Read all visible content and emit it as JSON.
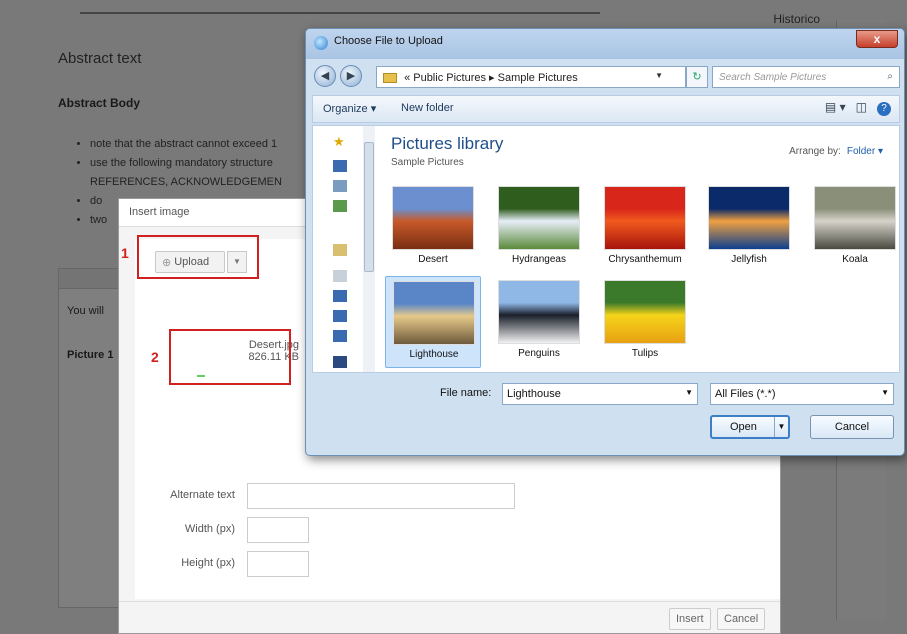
{
  "background_page": {
    "header_right": "Historico",
    "abstract_title": "Abstract text",
    "abstract_body_label": "Abstract Body",
    "bullets": [
      "note that the abstract cannot exceed 1",
      "use the following mandatory structure",
      "REFERENCES, ACKNOWLEDGEMEN",
      "do",
      "two"
    ],
    "editor_line1": "You will",
    "editor_line2": "Picture 1"
  },
  "insert_dialog": {
    "title": "Insert image",
    "upload_label": "Upload",
    "file_name": "Desert.jpg",
    "file_size": "826.11 KB",
    "annotation_1": "1",
    "annotation_2": "2",
    "alt_label": "Alternate text",
    "width_label": "Width (px)",
    "height_label": "Height (px)",
    "insert_label": "Insert",
    "cancel_label": "Cancel"
  },
  "file_dialog": {
    "title": "Choose File to Upload",
    "close_label": "x",
    "address": "« Public Pictures  ▸  Sample Pictures",
    "search_placeholder": "Search Sample Pictures",
    "organize_label": "Organize ▾",
    "new_folder_label": "New folder",
    "library_title": "Pictures library",
    "library_subtitle": "Sample Pictures",
    "arrange_by_label": "Arrange by:",
    "arrange_by_value": "Folder ▾",
    "thumbnails": [
      {
        "name": "Desert",
        "selected": false,
        "colors": [
          "#6b8fcf",
          "#c75a2a",
          "#7a2e12"
        ]
      },
      {
        "name": "Hydrangeas",
        "selected": false,
        "colors": [
          "#2f5d1e",
          "#e8eef8",
          "#5a8a3a"
        ]
      },
      {
        "name": "Chrysanthemum",
        "selected": false,
        "colors": [
          "#d8261a",
          "#f05a1e",
          "#a8140c"
        ]
      },
      {
        "name": "Jellyfish",
        "selected": false,
        "colors": [
          "#0a2a6a",
          "#f0a040",
          "#0c3f8f"
        ]
      },
      {
        "name": "Koala",
        "selected": false,
        "colors": [
          "#8a8f7a",
          "#d6d4ca",
          "#4a4a40"
        ]
      },
      {
        "name": "Lighthouse",
        "selected": true,
        "colors": [
          "#5a86c8",
          "#e6c98a",
          "#6e5a3c"
        ]
      },
      {
        "name": "Penguins",
        "selected": false,
        "colors": [
          "#8fb8e6",
          "#1a1f2a",
          "#f2f2f2"
        ]
      },
      {
        "name": "Tulips",
        "selected": false,
        "colors": [
          "#3a7a2a",
          "#f5d41a",
          "#e8a012"
        ]
      }
    ],
    "file_name_label": "File name:",
    "file_name_value": "Lighthouse",
    "filter_value": "All Files (*.*)",
    "open_label": "Open",
    "cancel_label": "Cancel"
  }
}
